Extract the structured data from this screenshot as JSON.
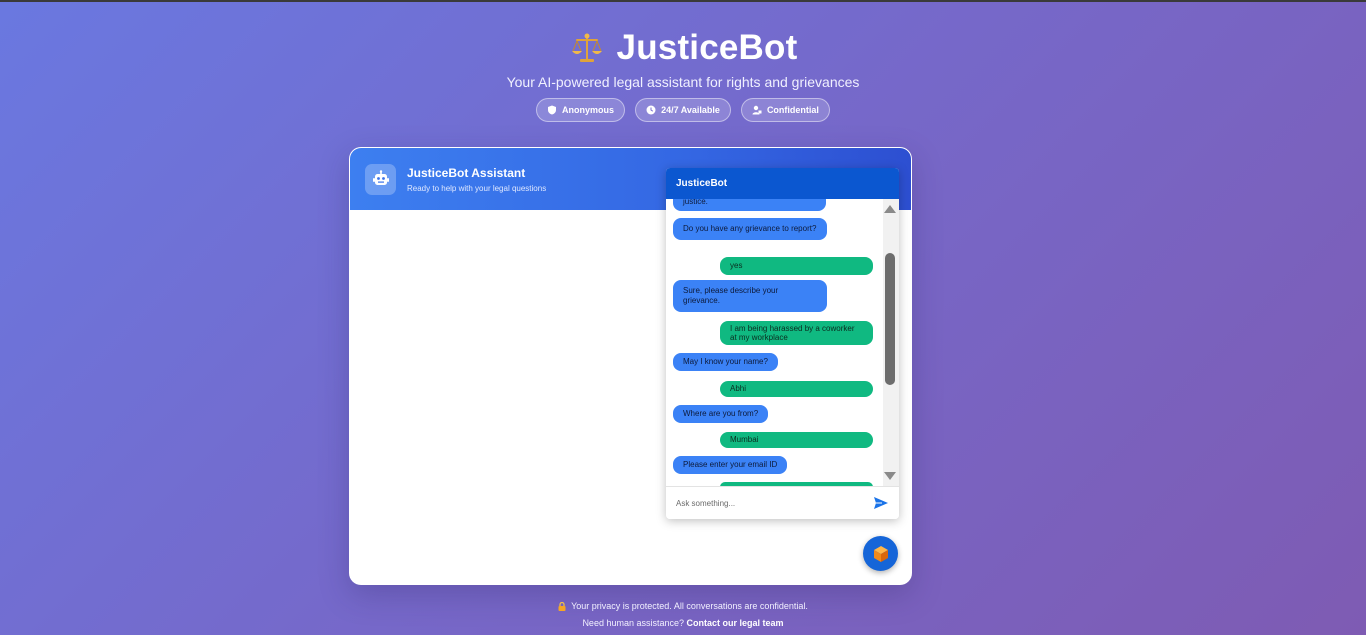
{
  "app": {
    "title": "JusticeBot",
    "subtitle": "Your AI-powered legal assistant for rights and grievances",
    "badges": [
      "Anonymous",
      "24/7 Available",
      "Confidential"
    ]
  },
  "card": {
    "title": "JusticeBot Assistant",
    "subtitle": "Ready to help with your legal questions"
  },
  "widget": {
    "title": "JusticeBot",
    "input_placeholder": "Ask something...",
    "messages": [
      {
        "from": "bot",
        "text": "justice."
      },
      {
        "from": "bot",
        "text": "Do you have any grievance to report?"
      },
      {
        "from": "user",
        "text": "yes"
      },
      {
        "from": "bot",
        "text": "Sure, please describe your grievance."
      },
      {
        "from": "user",
        "text": "I am being harassed by a coworker at my workplace"
      },
      {
        "from": "bot",
        "text": "May I know your name?"
      },
      {
        "from": "user",
        "text": "Abhi"
      },
      {
        "from": "bot",
        "text": "Where are you from?"
      },
      {
        "from": "user",
        "text": "Mumbai"
      },
      {
        "from": "bot",
        "text": "Please enter your email ID"
      }
    ]
  },
  "footer": {
    "privacy": "Your privacy is protected. All conversations are confidential.",
    "help_prefix": "Need human assistance?",
    "help_link": "Contact our legal team"
  },
  "colors": {
    "accent": "#3b82f6",
    "widget_header": "#0b57d0",
    "user_bubble": "#10b981"
  }
}
